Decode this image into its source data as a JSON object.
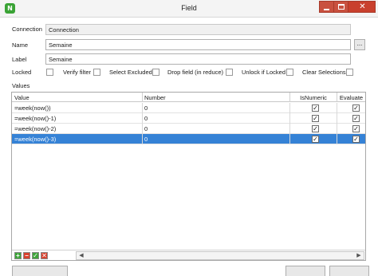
{
  "window": {
    "title": "Field",
    "app_icon": "N",
    "controls": {
      "minimize": "minimize-icon",
      "maximize": "maximize-icon",
      "close": "✕"
    }
  },
  "form": {
    "connection": {
      "label": "Connection",
      "value": "Connection"
    },
    "name": {
      "label": "Name",
      "value": "Semaine",
      "browse": "..."
    },
    "field_label": {
      "label": "Label",
      "value": "Semaine"
    }
  },
  "options": {
    "locked": "Locked",
    "verify_filter": "Verify filter",
    "select_excluded": "Select Excluded",
    "drop_field": "Drop field (in reduce)",
    "unlock_if_locked": "Unlock if Locked",
    "clear_selections": "Clear Selections"
  },
  "values": {
    "label": "Values",
    "columns": [
      "Value",
      "Number",
      "IsNumeric",
      "Evaluate"
    ],
    "rows": [
      {
        "value": "=week(now())",
        "number": "0",
        "is_numeric": true,
        "evaluate": true
      },
      {
        "value": "=week(now()-1)",
        "number": "0",
        "is_numeric": true,
        "evaluate": true
      },
      {
        "value": "=week(now()-2)",
        "number": "0",
        "is_numeric": true,
        "evaluate": true
      },
      {
        "value": "=week(now()-3)",
        "number": "0",
        "is_numeric": true,
        "evaluate": true,
        "selected": true
      }
    ]
  },
  "toolbar": {
    "add": "+",
    "remove": "−",
    "confirm": "✓",
    "delete": "✕"
  },
  "colors": {
    "accent": "#3582d6",
    "close_red": "#c9402d",
    "app_green": "#3aa335"
  }
}
